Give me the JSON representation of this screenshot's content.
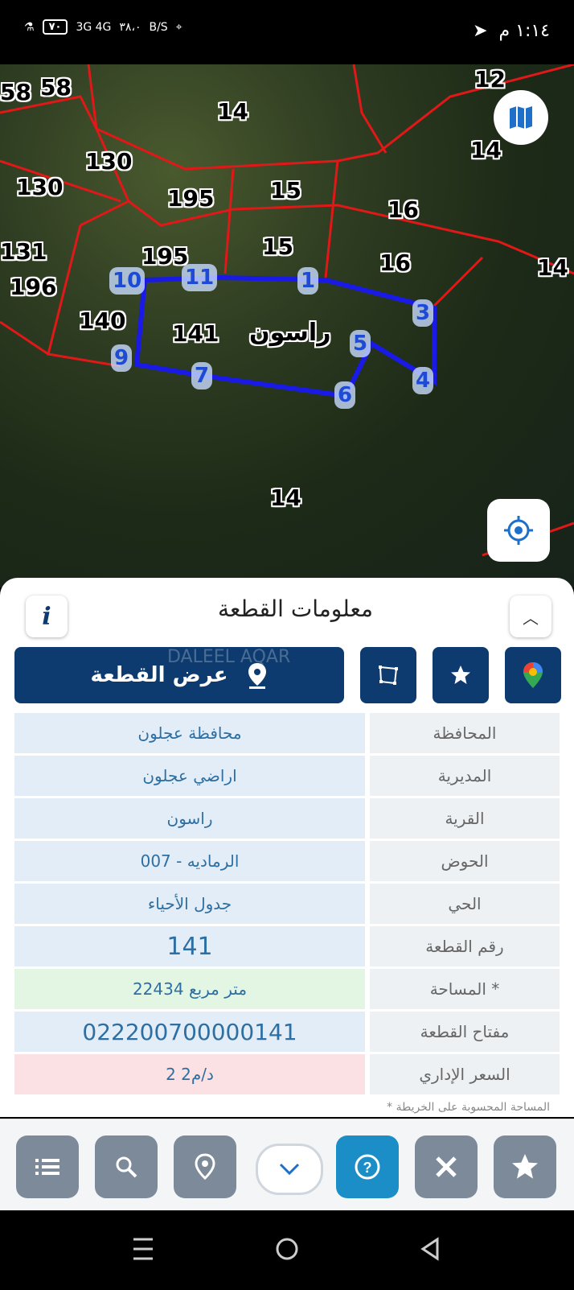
{
  "status": {
    "time": "١:١٤ م",
    "network": "3G 4G",
    "speed": "٣٨،٠",
    "speed_unit": "B/S",
    "battery": "٧٠"
  },
  "map": {
    "parcel_name": "راسون",
    "parcel_labels": [
      "58",
      "58",
      "12",
      "14",
      "130",
      "130",
      "14",
      "195",
      "15",
      "16",
      "131",
      "196",
      "195",
      "15",
      "16",
      "14",
      "140",
      "141",
      "14"
    ],
    "vertices": [
      "1",
      "3",
      "4",
      "5",
      "6",
      "7",
      "9",
      "10",
      "11"
    ]
  },
  "sheet": {
    "title": "معلومات القطعة",
    "show_parcel_label": "عرض القطعة",
    "watermark": "DALEEL AQAR",
    "rows": [
      {
        "key": "المحافظة",
        "value": "محافظة عجلون"
      },
      {
        "key": "المديرية",
        "value": "اراضي عجلون"
      },
      {
        "key": "القرية",
        "value": "راسون"
      },
      {
        "key": "الحوض",
        "value": "الرماديه - 007"
      },
      {
        "key": "الحي",
        "value": "جدول الأحياء"
      },
      {
        "key": "رقم القطعة",
        "value": "141"
      },
      {
        "key": "المساحة *",
        "value": "22434  متر مربع"
      },
      {
        "key": "مفتاح القطعة",
        "value": "022200700000141"
      },
      {
        "key": "السعر الإداري",
        "value": "2 د/م2"
      }
    ],
    "footnote": "* المساحة المحسوبة على الخريطة"
  },
  "colors": {
    "primary": "#0d3b6f",
    "accent": "#1b8ec7",
    "area_bg": "#e3f6e4",
    "price_bg": "#fbe1e4"
  }
}
